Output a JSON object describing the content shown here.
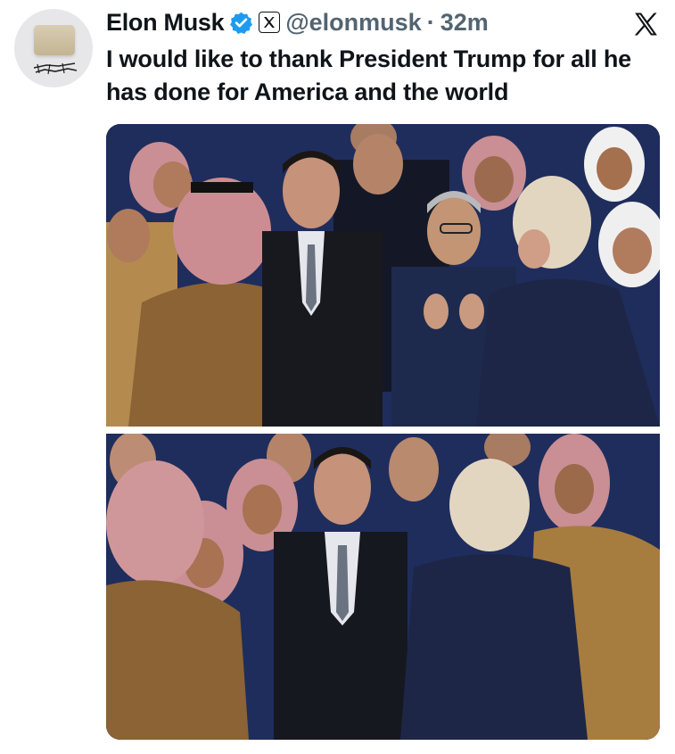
{
  "tweet": {
    "author_name": "Elon Musk",
    "handle": "@elonmusk",
    "separator": "·",
    "time": "32m",
    "text": "I would like to thank President Trump for all he has done for America and the world"
  },
  "icons": {
    "verified": "verified-badge-icon",
    "affiliate": "x-affiliate-icon",
    "platform": "x-logo-icon"
  },
  "colors": {
    "verified_blue": "#1d9bf0",
    "secondary_text": "#536471",
    "stage_backdrop": "#1c2a57"
  },
  "media": {
    "count": 2
  }
}
